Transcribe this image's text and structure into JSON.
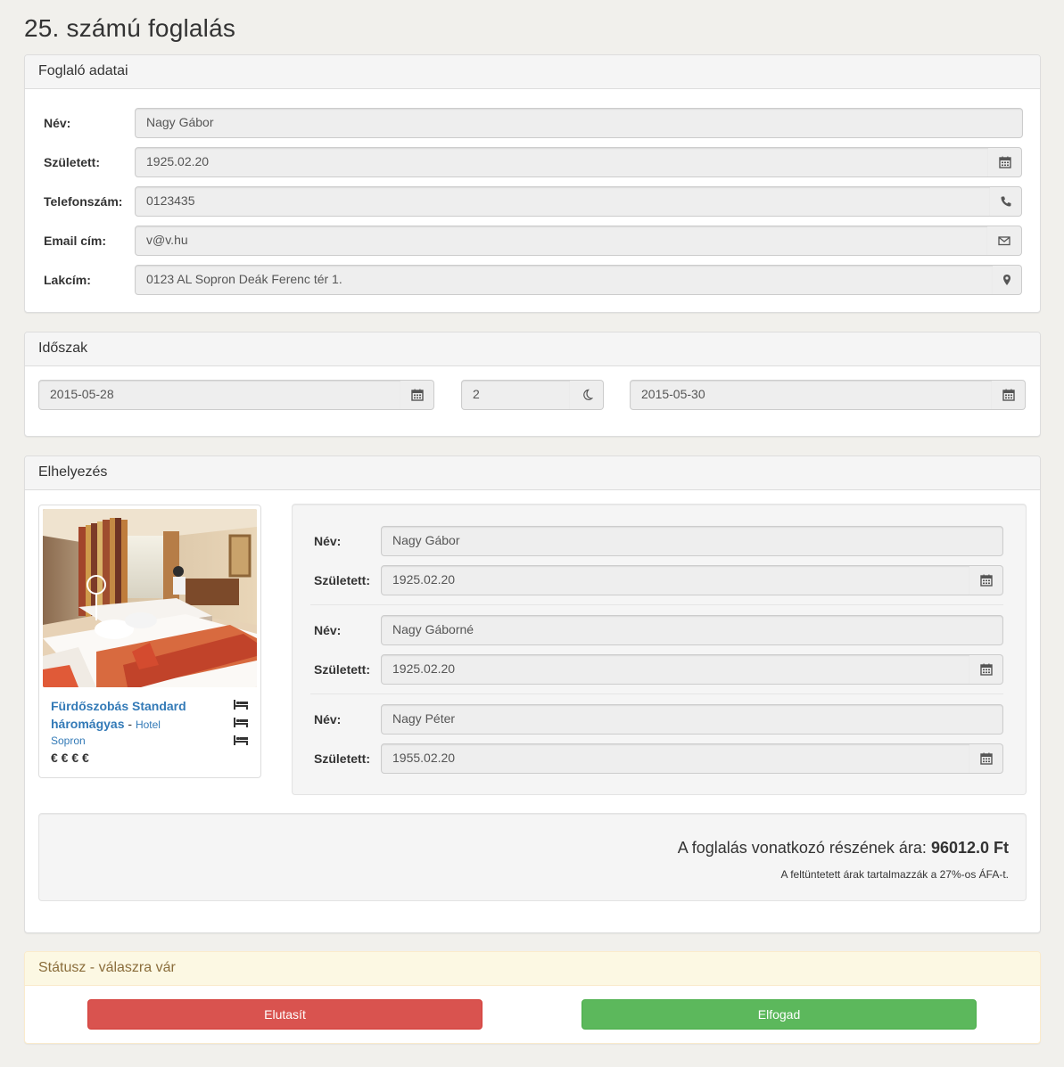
{
  "page_title": "25. számú foglalás",
  "booker": {
    "heading": "Foglaló adatai",
    "name_label": "Név:",
    "name_value": "Nagy Gábor",
    "birth_label": "Született:",
    "birth_value": "1925.02.20",
    "phone_label": "Telefonszám:",
    "phone_value": "0123435",
    "email_label": "Email cím:",
    "email_value": "v@v.hu",
    "address_label": "Lakcím:",
    "address_value": "0123 AL Sopron Deák Ferenc tér 1."
  },
  "period": {
    "heading": "Időszak",
    "start_date": "2015-05-28",
    "nights": "2",
    "end_date": "2015-05-30"
  },
  "placement": {
    "heading": "Elhelyezés",
    "room": {
      "title": "Fürdőszobás Standard háromágyas",
      "separator": " - ",
      "hotel": "Hotel",
      "location": "Sopron",
      "price_level": "€ € € €"
    },
    "guests": [
      {
        "name_label": "Név:",
        "name": "Nagy Gábor",
        "birth_label": "Született:",
        "birth": "1925.02.20"
      },
      {
        "name_label": "Név:",
        "name": "Nagy Gáborné",
        "birth_label": "Született:",
        "birth": "1925.02.20"
      },
      {
        "name_label": "Név:",
        "name": "Nagy Péter",
        "birth_label": "Született:",
        "birth": "1955.02.20"
      }
    ],
    "price_prefix": "A foglalás vonatkozó részének ára:",
    "price_value": "96012.0 Ft",
    "vat_note": "A feltüntetett árak tartalmazzák a 27%-os ÁFA-t."
  },
  "status": {
    "heading": "Státusz - válaszra vár",
    "reject_label": "Elutasít",
    "accept_label": "Elfogad"
  },
  "colors": {
    "danger": "#d9534f",
    "success": "#5cb85c",
    "link": "#337ab7",
    "warning_bg": "#fcf8e3"
  }
}
